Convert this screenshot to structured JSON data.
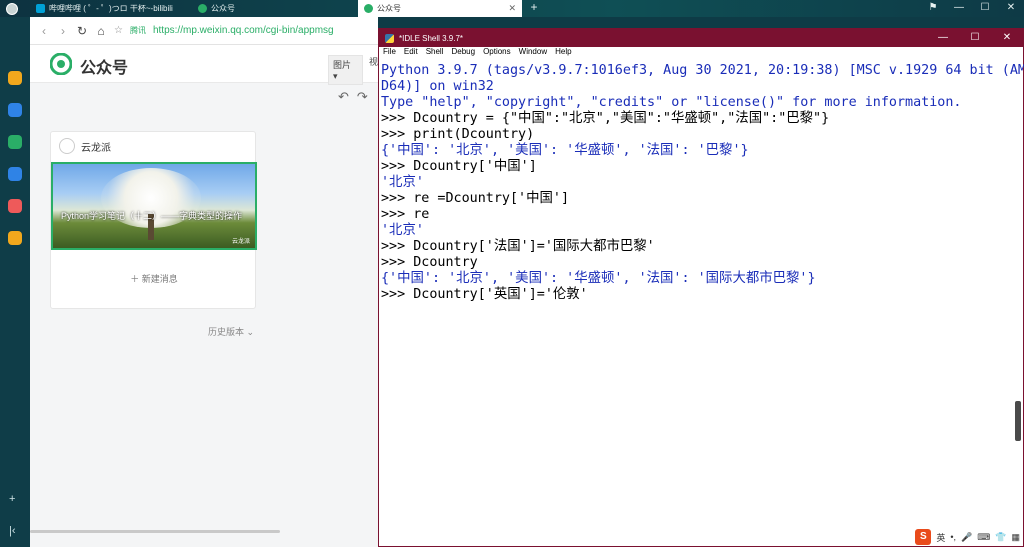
{
  "tabs": [
    {
      "label": "哔哩哔哩 ( ゜- ゜)つロ 干杯~-bilibili"
    },
    {
      "label": "公众号"
    },
    {
      "label": "公众号"
    }
  ],
  "address_bar": {
    "secure_label": "腾讯",
    "url": "https://mp.weixin.qq.com/cgi-bin/appmsg"
  },
  "wx": {
    "title": "公众号",
    "tool_image": "图片 ▾",
    "tool_video": "视"
  },
  "card": {
    "account_name": "云龙派",
    "cover_title": "Python学习笔记（十二）——字典类型的操作",
    "cover_badge": "云龙派",
    "new_message": "新建消息",
    "history": "历史版本"
  },
  "idle": {
    "window_title": "*IDLE Shell 3.9.7*",
    "menu": [
      "File",
      "Edit",
      "Shell",
      "Debug",
      "Options",
      "Window",
      "Help"
    ],
    "lines": [
      {
        "cls": "out",
        "text": "Python 3.9.7 (tags/v3.9.7:1016ef3, Aug 30 2021, 20:19:38) [MSC v.1929 64 bit (AM"
      },
      {
        "cls": "out",
        "text": "D64)] on win32"
      },
      {
        "cls": "out",
        "text": "Type \"help\", \"copyright\", \"credits\" or \"license()\" for more information."
      },
      {
        "cls": "in",
        "text": ">>> Dcountry = {\"中国\":\"北京\",\"美国\":\"华盛顿\",\"法国\":\"巴黎\"}"
      },
      {
        "cls": "in",
        "text": ">>> print(Dcountry)"
      },
      {
        "cls": "stdout",
        "text": "{'中国': '北京', '美国': '华盛顿', '法国': '巴黎'}"
      },
      {
        "cls": "in",
        "text": ">>> Dcountry['中国']"
      },
      {
        "cls": "stdout",
        "text": "'北京'"
      },
      {
        "cls": "in",
        "text": ">>> re =Dcountry['中国']"
      },
      {
        "cls": "in",
        "text": ">>> re"
      },
      {
        "cls": "stdout",
        "text": "'北京'"
      },
      {
        "cls": "in",
        "text": ">>> Dcountry['法国']='国际大都市巴黎'"
      },
      {
        "cls": "in",
        "text": ">>> Dcountry"
      },
      {
        "cls": "stdout",
        "text": "{'中国': '北京', '美国': '华盛顿', '法国': '国际大都市巴黎'}"
      },
      {
        "cls": "in",
        "text": ">>> Dcountry['英国']='伦敦'"
      }
    ]
  },
  "tray": {
    "ime": "英",
    "ime_logo": "S"
  }
}
